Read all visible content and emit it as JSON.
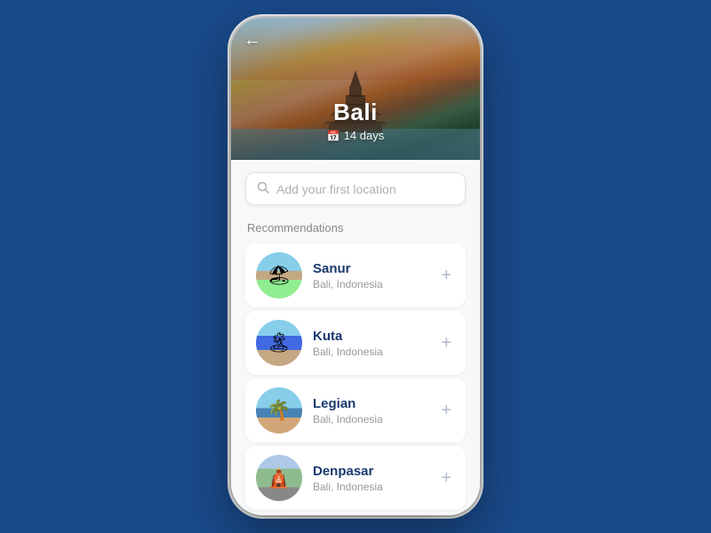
{
  "hero": {
    "title": "Bali",
    "days": "14 days",
    "back_label": "←"
  },
  "search": {
    "placeholder": "Add your first location"
  },
  "recommendations": {
    "section_title": "Recommendations",
    "items": [
      {
        "id": "sanur",
        "name": "Sanur",
        "location": "Bali, Indonesia",
        "avatar_class": "avatar-sanur"
      },
      {
        "id": "kuta",
        "name": "Kuta",
        "location": "Bali, Indonesia",
        "avatar_class": "avatar-kuta"
      },
      {
        "id": "legian",
        "name": "Legian",
        "location": "Bali, Indonesia",
        "avatar_class": "avatar-legian"
      },
      {
        "id": "denpasar",
        "name": "Denpasar",
        "location": "Bali, Indonesia",
        "avatar_class": "avatar-denpasar"
      }
    ]
  }
}
